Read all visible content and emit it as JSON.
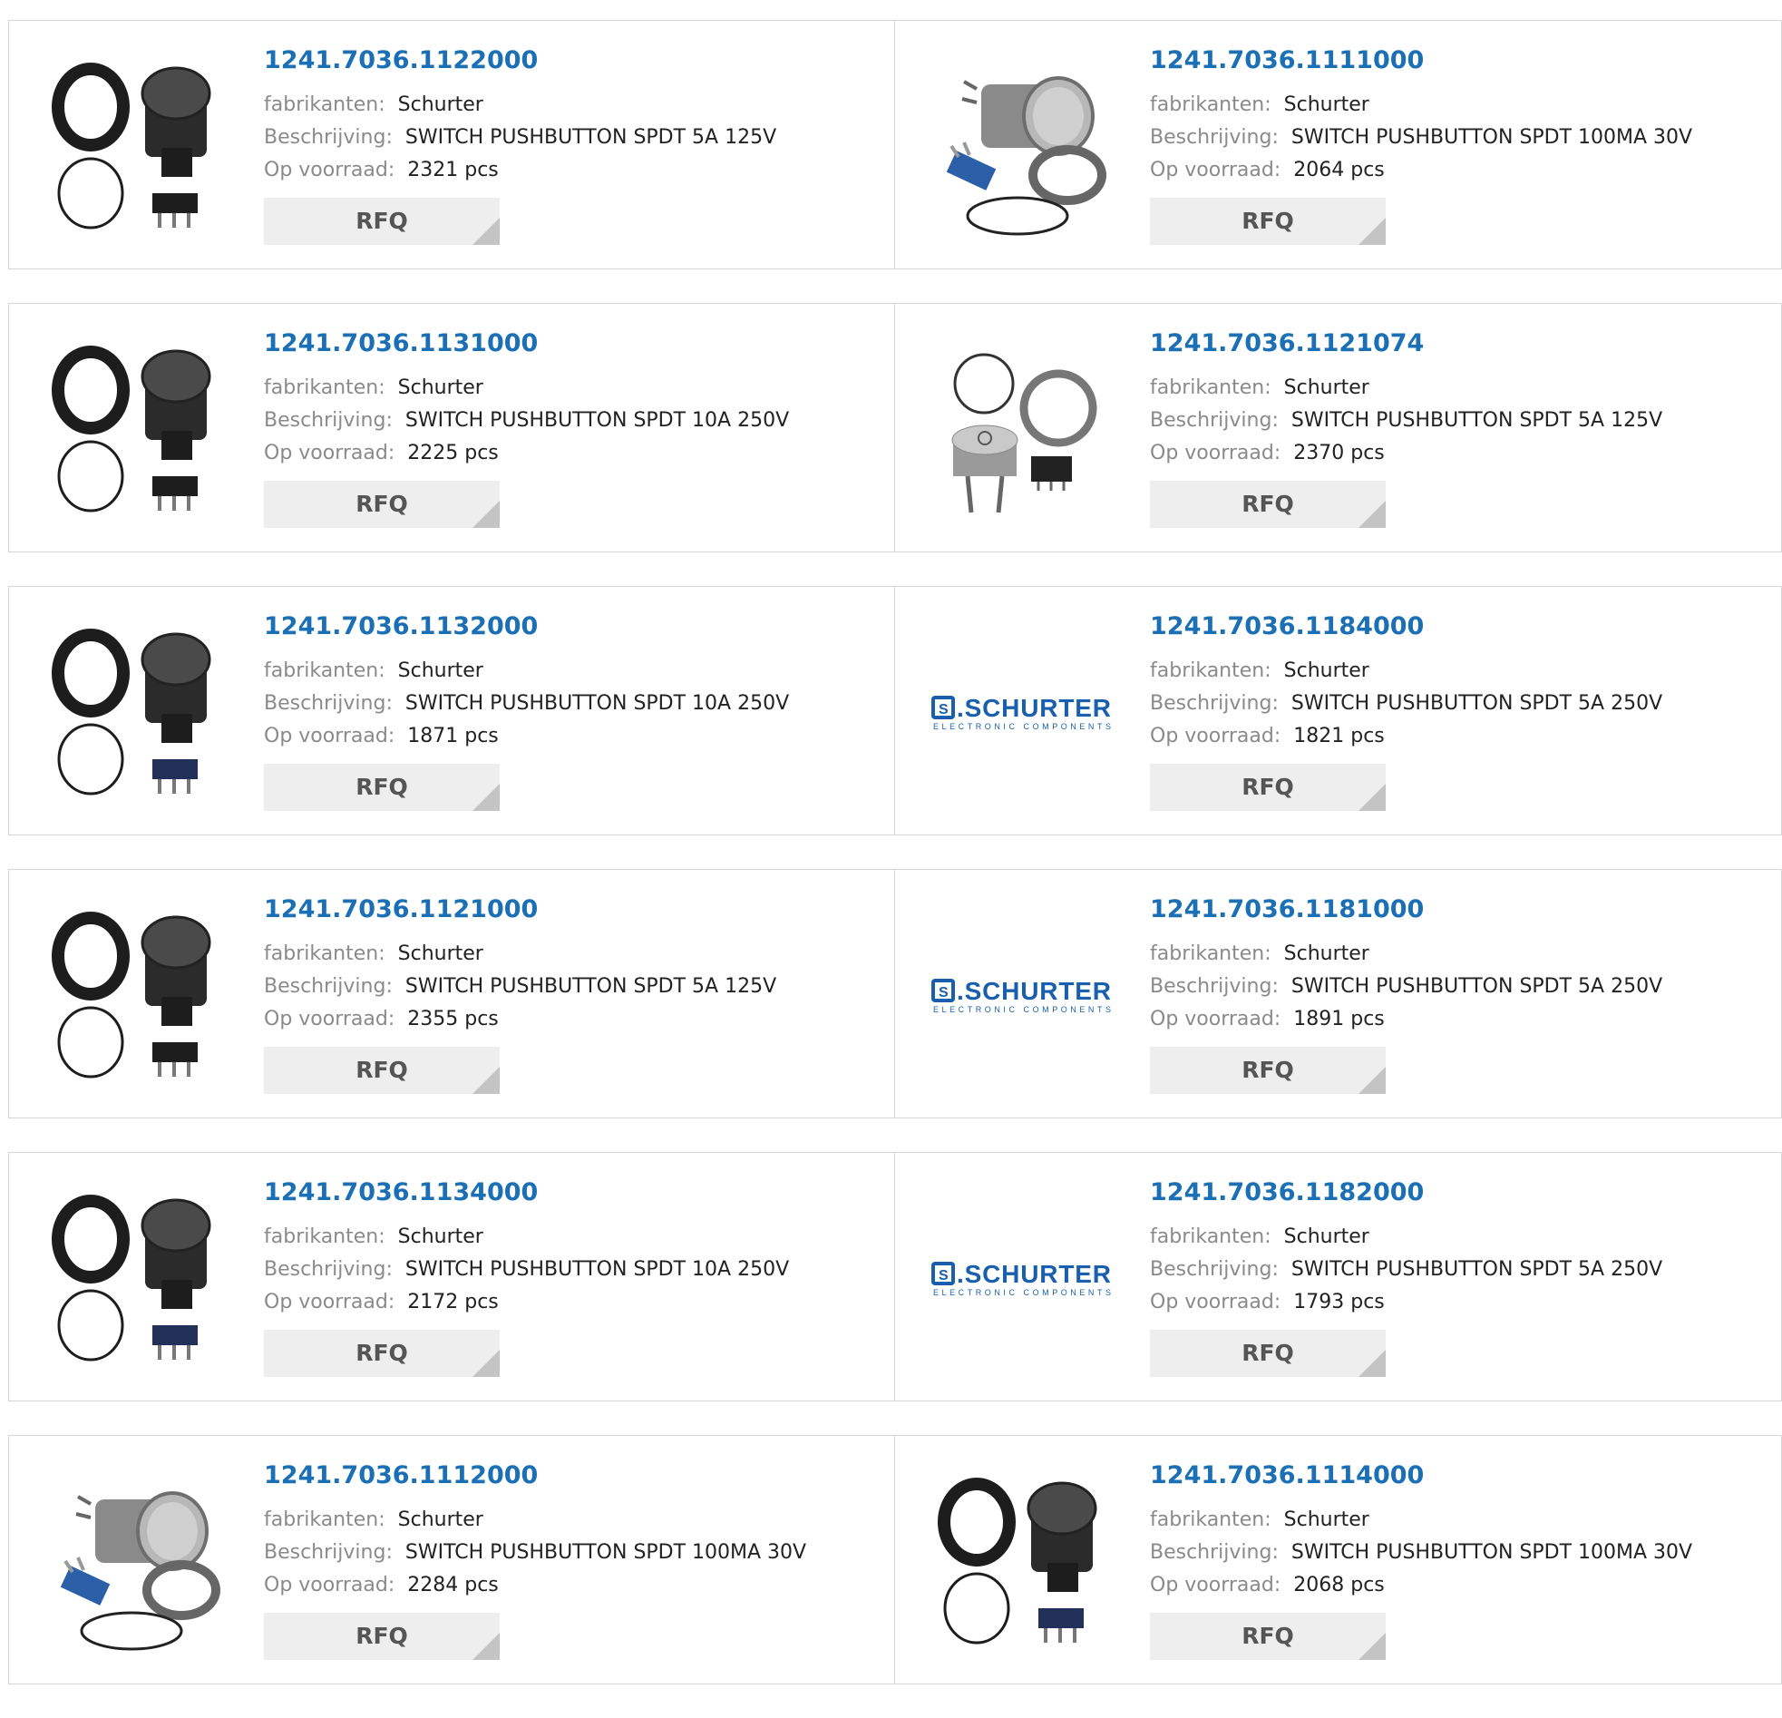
{
  "labels": {
    "manufacturer": "fabrikanten:",
    "description": "Beschrijving:",
    "stock": "Op voorraad:",
    "rfq": "RFQ"
  },
  "logo": {
    "brand": "SCHURTER",
    "tagline": "ELECTRONIC COMPONENTS",
    "color": "#1a5fae"
  },
  "accent": "#1a6fb5",
  "products": [
    {
      "part": "1241.7036.1122000",
      "manufacturer": "Schurter",
      "description": "SWITCH PUSHBUTTON SPDT 5A 125V",
      "stock": "2321 pcs",
      "image": "black-pushbutton-kit"
    },
    {
      "part": "1241.7036.1111000",
      "manufacturer": "Schurter",
      "description": "SWITCH PUSHBUTTON SPDT 100MA 30V",
      "stock": "2064 pcs",
      "image": "metal-pushbutton-kit"
    },
    {
      "part": "1241.7036.1131000",
      "manufacturer": "Schurter",
      "description": "SWITCH PUSHBUTTON SPDT 10A 250V",
      "stock": "2225 pcs",
      "image": "black-pushbutton-kit"
    },
    {
      "part": "1241.7036.1121074",
      "manufacturer": "Schurter",
      "description": "SWITCH PUSHBUTTON SPDT 5A 125V",
      "stock": "2370 pcs",
      "image": "metal-power-pushbutton-kit"
    },
    {
      "part": "1241.7036.1132000",
      "manufacturer": "Schurter",
      "description": "SWITCH PUSHBUTTON SPDT 10A 250V",
      "stock": "1871 pcs",
      "image": "black-pushbutton-kit-blue"
    },
    {
      "part": "1241.7036.1184000",
      "manufacturer": "Schurter",
      "description": "SWITCH PUSHBUTTON SPDT 5A 250V",
      "stock": "1821 pcs",
      "image": "schurter-logo"
    },
    {
      "part": "1241.7036.1121000",
      "manufacturer": "Schurter",
      "description": "SWITCH PUSHBUTTON SPDT 5A 125V",
      "stock": "2355 pcs",
      "image": "black-pushbutton-kit"
    },
    {
      "part": "1241.7036.1181000",
      "manufacturer": "Schurter",
      "description": "SWITCH PUSHBUTTON SPDT 5A 250V",
      "stock": "1891 pcs",
      "image": "schurter-logo"
    },
    {
      "part": "1241.7036.1134000",
      "manufacturer": "Schurter",
      "description": "SWITCH PUSHBUTTON SPDT 10A 250V",
      "stock": "2172 pcs",
      "image": "black-pushbutton-kit-blue"
    },
    {
      "part": "1241.7036.1182000",
      "manufacturer": "Schurter",
      "description": "SWITCH PUSHBUTTON SPDT 5A 250V",
      "stock": "1793 pcs",
      "image": "schurter-logo"
    },
    {
      "part": "1241.7036.1112000",
      "manufacturer": "Schurter",
      "description": "SWITCH PUSHBUTTON SPDT 100MA 30V",
      "stock": "2284 pcs",
      "image": "metal-pushbutton-kit"
    },
    {
      "part": "1241.7036.1114000",
      "manufacturer": "Schurter",
      "description": "SWITCH PUSHBUTTON SPDT 100MA 30V",
      "stock": "2068 pcs",
      "image": "black-pushbutton-kit-blue"
    }
  ]
}
